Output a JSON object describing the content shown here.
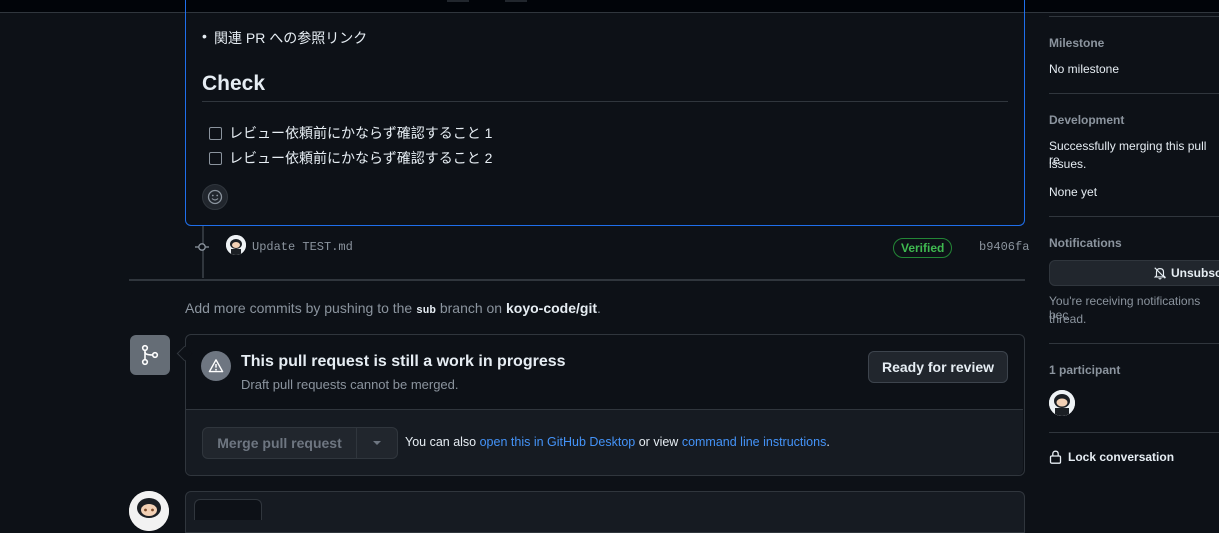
{
  "body": {
    "bullet_item": "関連 PR への参照リンク",
    "check_heading": "Check",
    "tasks": [
      {
        "label": "レビュー依頼前にかならず確認すること 1",
        "checked": false
      },
      {
        "label": "レビュー依頼前にかならず確認すること 2",
        "checked": false
      }
    ]
  },
  "commit": {
    "message": "Update TEST.md",
    "badge": "Verified",
    "sha": "b9406fa"
  },
  "push_note": {
    "prefix": "Add more commits by pushing to the",
    "branch": "sub",
    "middle": "branch on",
    "repo": "koyo-code/git",
    "suffix": "."
  },
  "merge": {
    "title": "This pull request is still a work in progress",
    "subtitle": "Draft pull requests cannot be merged.",
    "ready_button": "Ready for review",
    "merge_button": "Merge pull request",
    "alt_prefix": "You can also",
    "alt_link_desktop": "open this in GitHub Desktop",
    "alt_middle": "or view",
    "alt_link_cli": "command line instructions",
    "alt_suffix": "."
  },
  "sidebar": {
    "milestone_label": "Milestone",
    "milestone_value": "No milestone",
    "development_label": "Development",
    "development_line1": "Successfully merging this pull re",
    "development_line2": "issues.",
    "development_value": "None yet",
    "notifications_label": "Notifications",
    "unsubscribe_button": "Unsubsc",
    "notifications_note_line1": "You're receiving notifications bec",
    "notifications_note_line2": "thread.",
    "participants_label": "1 participant",
    "lock_label": "Lock conversation"
  },
  "colors": {
    "background": "#0d1117",
    "accent_blue": "#4493f8",
    "verified_green": "#3fb950",
    "border": "#30363d"
  }
}
